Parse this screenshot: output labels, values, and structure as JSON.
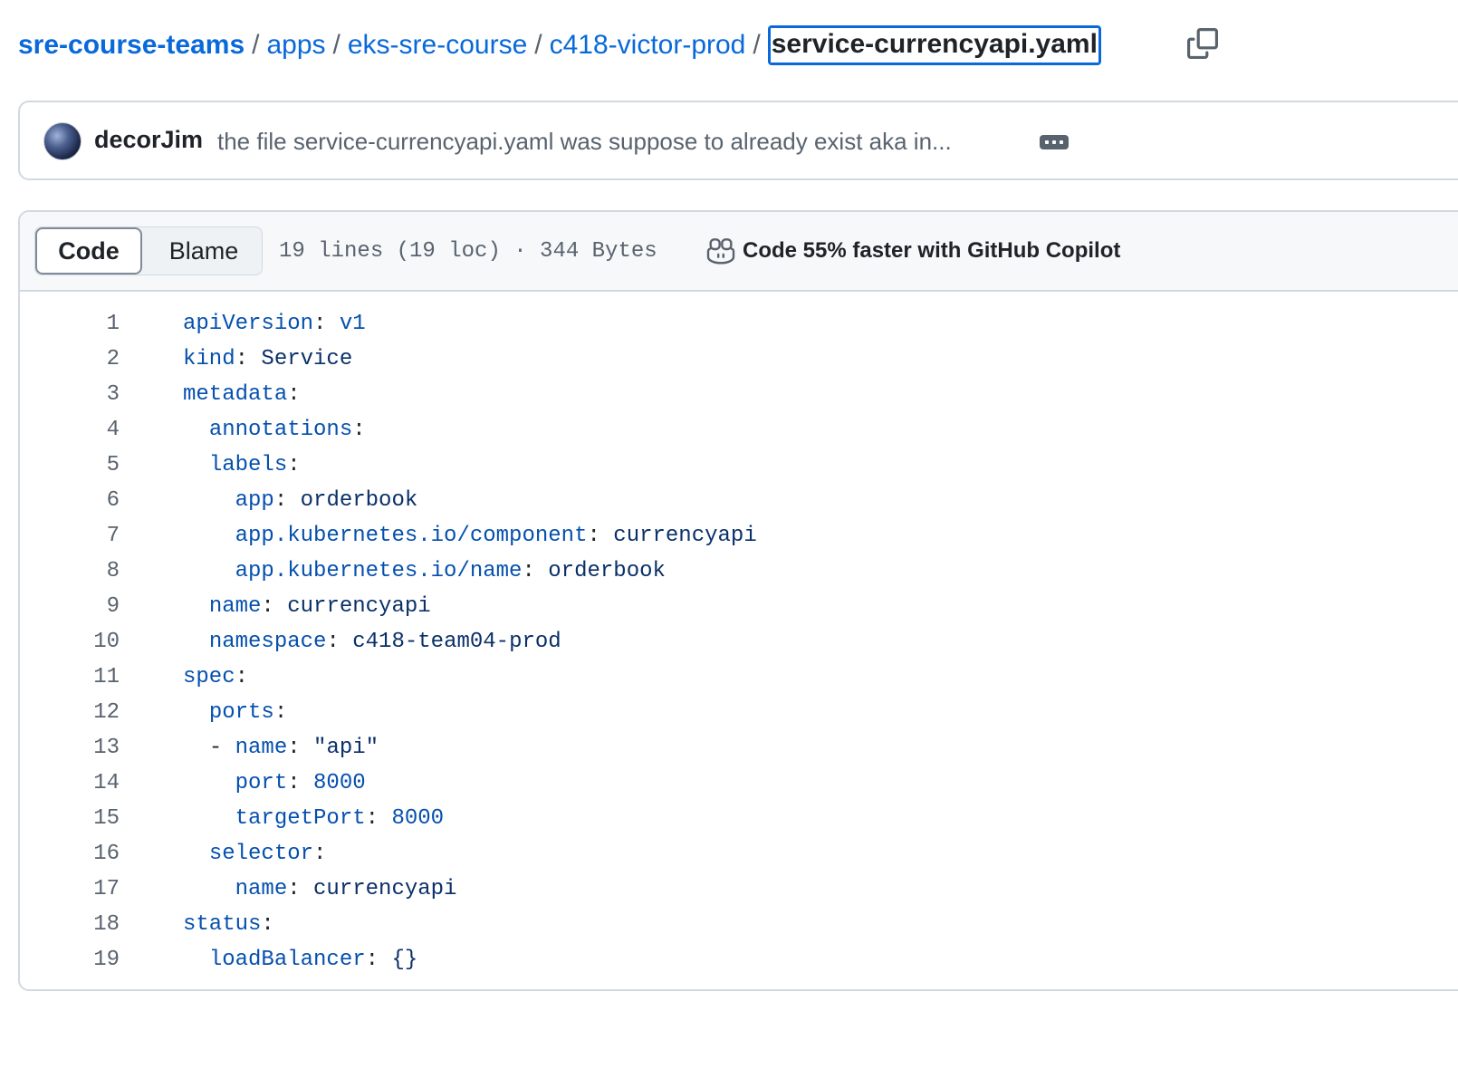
{
  "breadcrumb": {
    "items": [
      "sre-course-teams",
      "apps",
      "eks-sre-course",
      "c418-victor-prod"
    ],
    "current": "service-currencyapi.yaml",
    "separator": "/"
  },
  "commit": {
    "author": "decorJim",
    "message": "the file service-currencyapi.yaml was suppose to already exist aka in..."
  },
  "file_header": {
    "code_tab": "Code",
    "blame_tab": "Blame",
    "meta": "19 lines (19 loc) · 344 Bytes",
    "copilot": "Code 55% faster with GitHub Copilot"
  },
  "code_lines": [
    {
      "num": "1",
      "indent": "",
      "dash": "",
      "key": "apiVersion",
      "value": "v1",
      "vtype": "num"
    },
    {
      "num": "2",
      "indent": "",
      "dash": "",
      "key": "kind",
      "value": "Service",
      "vtype": "str"
    },
    {
      "num": "3",
      "indent": "",
      "dash": "",
      "key": "metadata",
      "value": "",
      "vtype": "str"
    },
    {
      "num": "4",
      "indent": "  ",
      "dash": "",
      "key": "annotations",
      "value": "",
      "vtype": "str"
    },
    {
      "num": "5",
      "indent": "  ",
      "dash": "",
      "key": "labels",
      "value": "",
      "vtype": "str"
    },
    {
      "num": "6",
      "indent": "    ",
      "dash": "",
      "key": "app",
      "value": "orderbook",
      "vtype": "str"
    },
    {
      "num": "7",
      "indent": "    ",
      "dash": "",
      "key": "app.kubernetes.io/component",
      "value": "currencyapi",
      "vtype": "str"
    },
    {
      "num": "8",
      "indent": "    ",
      "dash": "",
      "key": "app.kubernetes.io/name",
      "value": "orderbook",
      "vtype": "str"
    },
    {
      "num": "9",
      "indent": "  ",
      "dash": "",
      "key": "name",
      "value": "currencyapi",
      "vtype": "str"
    },
    {
      "num": "10",
      "indent": "  ",
      "dash": "",
      "key": "namespace",
      "value": "c418-team04-prod",
      "vtype": "str"
    },
    {
      "num": "11",
      "indent": "",
      "dash": "",
      "key": "spec",
      "value": "",
      "vtype": "str"
    },
    {
      "num": "12",
      "indent": "  ",
      "dash": "",
      "key": "ports",
      "value": "",
      "vtype": "str"
    },
    {
      "num": "13",
      "indent": "  ",
      "dash": "- ",
      "key": "name",
      "value": "\"api\"",
      "vtype": "str"
    },
    {
      "num": "14",
      "indent": "    ",
      "dash": "",
      "key": "port",
      "value": "8000",
      "vtype": "num"
    },
    {
      "num": "15",
      "indent": "    ",
      "dash": "",
      "key": "targetPort",
      "value": "8000",
      "vtype": "num"
    },
    {
      "num": "16",
      "indent": "  ",
      "dash": "",
      "key": "selector",
      "value": "",
      "vtype": "str"
    },
    {
      "num": "17",
      "indent": "    ",
      "dash": "",
      "key": "name",
      "value": "currencyapi",
      "vtype": "str"
    },
    {
      "num": "18",
      "indent": "",
      "dash": "",
      "key": "status",
      "value": "",
      "vtype": "str"
    },
    {
      "num": "19",
      "indent": "  ",
      "dash": "",
      "key": "loadBalancer",
      "value": "{}",
      "vtype": "str"
    }
  ]
}
